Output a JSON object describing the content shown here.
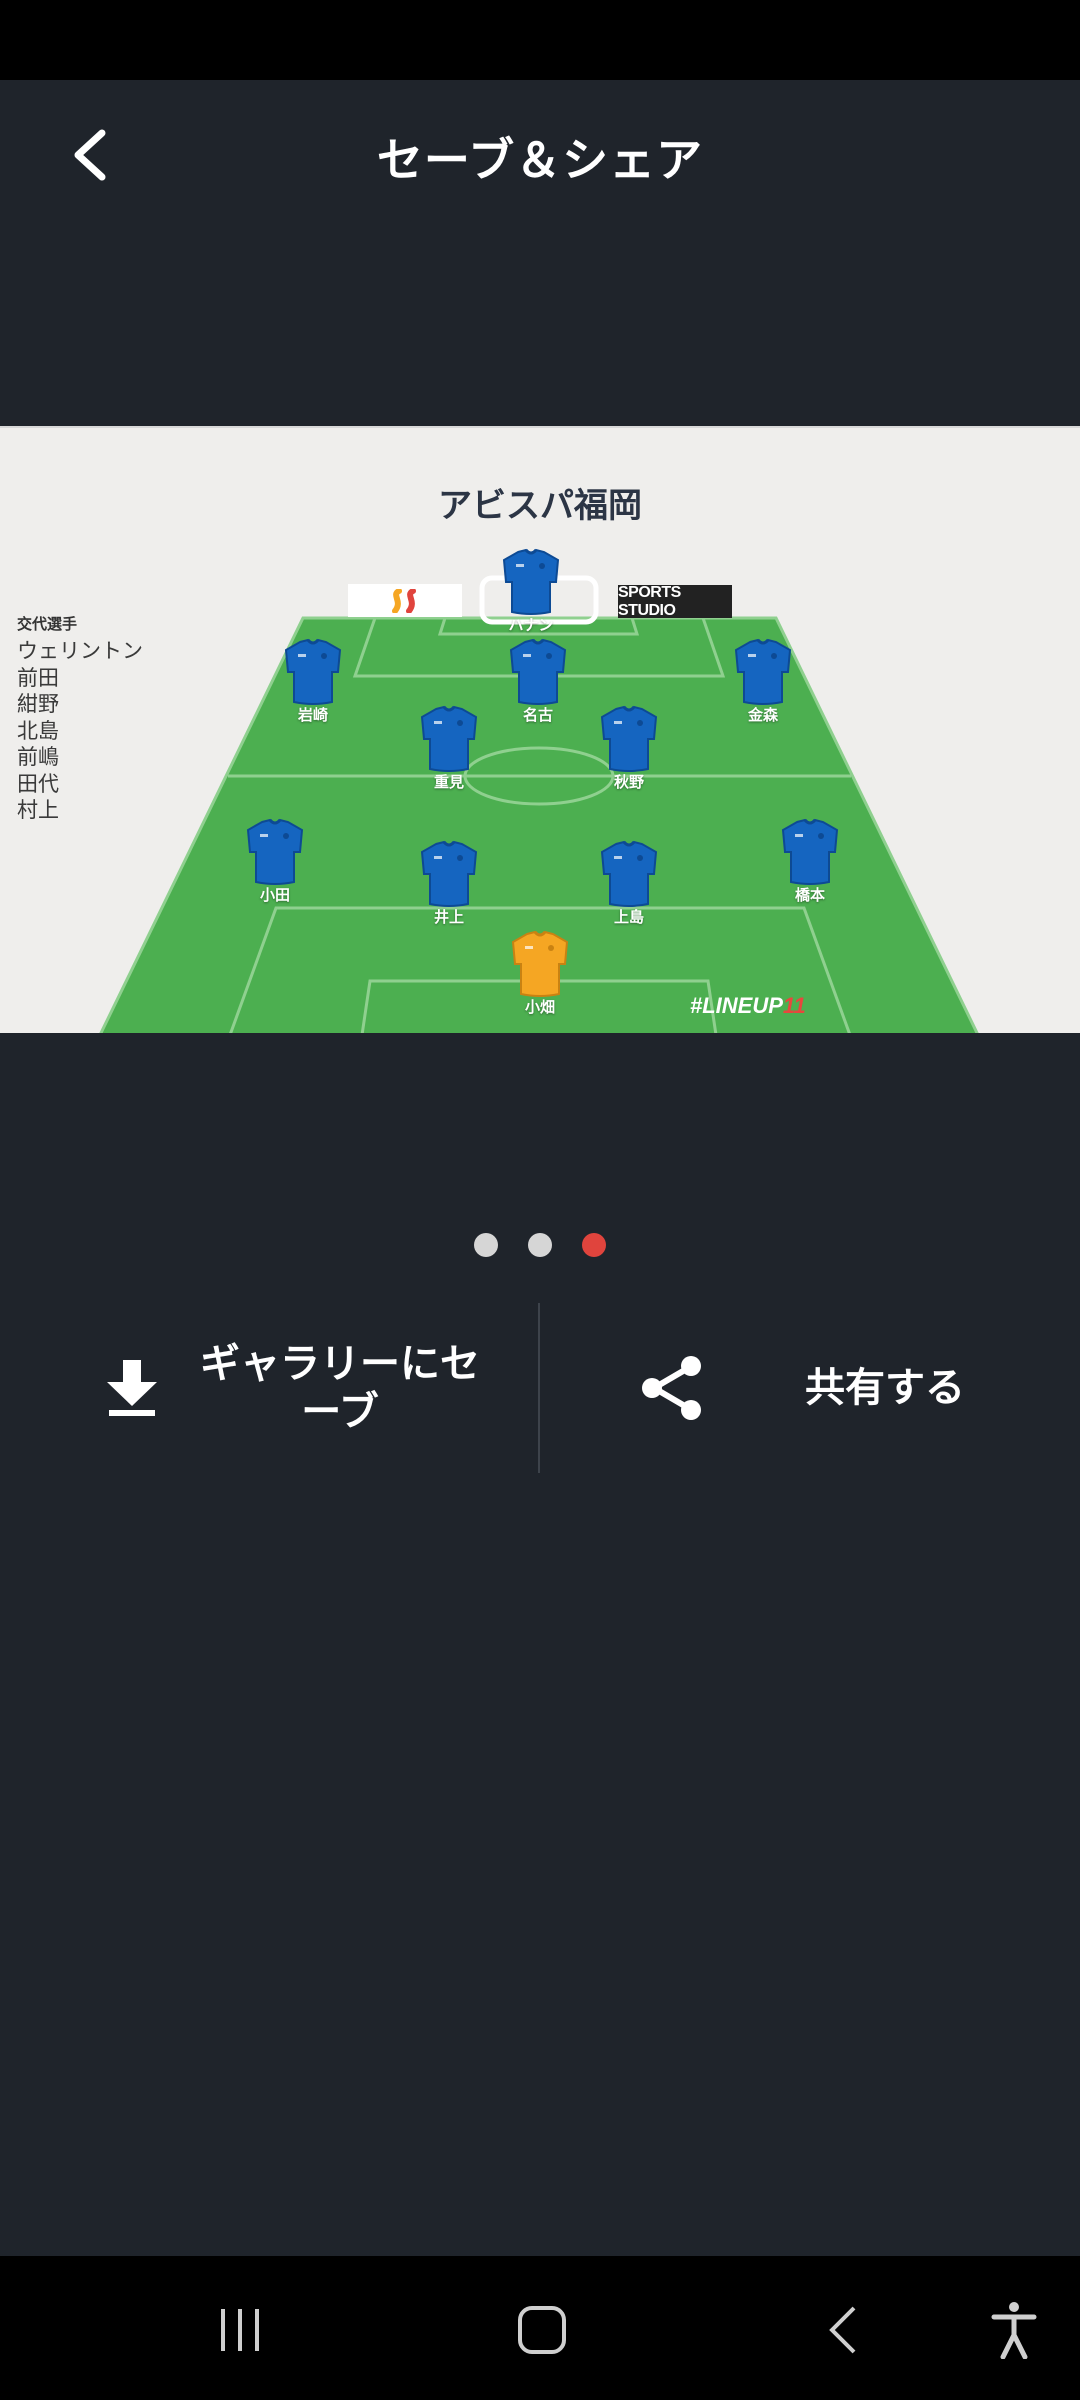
{
  "header": {
    "title": "セーブ＆シェア"
  },
  "lineup": {
    "team_name": "アビスパ福岡",
    "subs_title": "交代選手",
    "substitutes": [
      "ウェリントン",
      "前田",
      "紺野",
      "北島",
      "前嶋",
      "田代",
      "村上"
    ],
    "sponsor_right": "SPORTS STUDIO",
    "hashtag_prefix": "#LINEUP",
    "hashtag_number": "11",
    "kit_color_field": "#1565c0",
    "kit_color_keeper": "#f5a623",
    "pitch_color": "#4caf50",
    "players": [
      {
        "name": "ハナン",
        "role": "field"
      },
      {
        "name": "岩崎",
        "role": "field"
      },
      {
        "name": "名古",
        "role": "field"
      },
      {
        "name": "金森",
        "role": "field"
      },
      {
        "name": "重見",
        "role": "field"
      },
      {
        "name": "秋野",
        "role": "field"
      },
      {
        "name": "小田",
        "role": "field"
      },
      {
        "name": "井上",
        "role": "field"
      },
      {
        "name": "上島",
        "role": "field"
      },
      {
        "name": "橋本",
        "role": "field"
      },
      {
        "name": "小畑",
        "role": "keeper"
      }
    ]
  },
  "pager": {
    "count": 3,
    "active_index": 2
  },
  "actions": {
    "save_label": "ギャラリーにセーブ",
    "share_label": "共有する"
  },
  "icons": {
    "back": "chevron-left-icon",
    "save": "download-icon",
    "share": "share-icon",
    "nav_recents": "recents-icon",
    "nav_home": "home-icon",
    "nav_back": "back-icon",
    "nav_accessibility": "accessibility-icon"
  }
}
